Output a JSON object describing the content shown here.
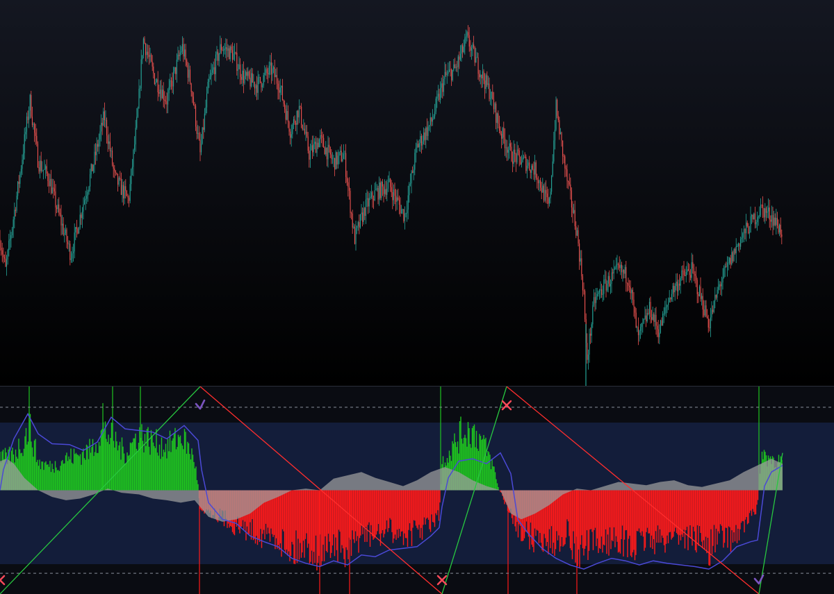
{
  "colors": {
    "background_top": "#141721",
    "background_bottom": "#000000",
    "candle_up": "#26a69a",
    "candle_down": "#ef5350",
    "osc_positive": "#1fc41f",
    "osc_negative": "#ff1a1a",
    "osc_band": "#131d3a",
    "signal_line": "#4b49d6",
    "volume_area": "#9e9e9e",
    "trend_up_line": "#28c840",
    "trend_down_line": "#ff2e2e",
    "marker_x": "#ff4a5a",
    "marker_check": "#7b55c0",
    "dashed_level": "#8a8f9c",
    "pane_divider": "#2a2e39"
  },
  "chart_data": [
    {
      "type": "candlestick",
      "pane": "price",
      "title": "",
      "xlabel": "",
      "ylabel": "",
      "grid": false,
      "legend": "none",
      "ylim": [
        55,
        105
      ],
      "close_path": [
        [
          0,
          74
        ],
        [
          8,
          70
        ],
        [
          28,
          82
        ],
        [
          43,
          92
        ],
        [
          55,
          84
        ],
        [
          70,
          82
        ],
        [
          82,
          78
        ],
        [
          102,
          72
        ],
        [
          118,
          78
        ],
        [
          135,
          84
        ],
        [
          150,
          90
        ],
        [
          165,
          82
        ],
        [
          185,
          79
        ],
        [
          198,
          90
        ],
        [
          206,
          100
        ],
        [
          222,
          95
        ],
        [
          240,
          92
        ],
        [
          262,
          99
        ],
        [
          275,
          94
        ],
        [
          288,
          85
        ],
        [
          300,
          94
        ],
        [
          318,
          99
        ],
        [
          335,
          98
        ],
        [
          350,
          95
        ],
        [
          370,
          94
        ],
        [
          390,
          96
        ],
        [
          402,
          94
        ],
        [
          418,
          88
        ],
        [
          430,
          91
        ],
        [
          445,
          85
        ],
        [
          460,
          87
        ],
        [
          480,
          84
        ],
        [
          495,
          85
        ],
        [
          510,
          74
        ],
        [
          525,
          78
        ],
        [
          540,
          80
        ],
        [
          560,
          81
        ],
        [
          582,
          77
        ],
        [
          600,
          86
        ],
        [
          620,
          89
        ],
        [
          640,
          95
        ],
        [
          655,
          96
        ],
        [
          672,
          100
        ],
        [
          690,
          96
        ],
        [
          705,
          93
        ],
        [
          720,
          88
        ],
        [
          735,
          85
        ],
        [
          755,
          84
        ],
        [
          770,
          83
        ],
        [
          790,
          78
        ],
        [
          800,
          91
        ],
        [
          815,
          82
        ],
        [
          830,
          75
        ],
        [
          840,
          67
        ],
        [
          844,
          58
        ],
        [
          855,
          66
        ],
        [
          870,
          68
        ],
        [
          890,
          70
        ],
        [
          905,
          69
        ],
        [
          918,
          61
        ],
        [
          935,
          65
        ],
        [
          948,
          62
        ],
        [
          965,
          67
        ],
        [
          980,
          69
        ],
        [
          995,
          70
        ],
        [
          1010,
          66
        ],
        [
          1020,
          63
        ],
        [
          1035,
          68
        ],
        [
          1050,
          71
        ],
        [
          1065,
          74
        ],
        [
          1080,
          76
        ],
        [
          1095,
          78
        ],
        [
          1110,
          77
        ],
        [
          1125,
          75
        ]
      ]
    },
    {
      "type": "bar",
      "pane": "oscillator",
      "title": "",
      "xlabel": "",
      "ylabel": "",
      "grid": false,
      "legend": "none",
      "ylim": [
        -1.25,
        1.25
      ],
      "levels": [
        1,
        -1
      ],
      "oscillator_path": [
        [
          0,
          0.45
        ],
        [
          20,
          0.55
        ],
        [
          35,
          0.75
        ],
        [
          42,
          0.98
        ],
        [
          55,
          0.42
        ],
        [
          75,
          0.35
        ],
        [
          95,
          0.48
        ],
        [
          110,
          0.52
        ],
        [
          130,
          0.6
        ],
        [
          148,
          0.9
        ],
        [
          162,
          0.78
        ],
        [
          180,
          0.55
        ],
        [
          200,
          0.85
        ],
        [
          220,
          0.72
        ],
        [
          240,
          0.65
        ],
        [
          262,
          0.82
        ],
        [
          280,
          0.45
        ],
        [
          286,
          0.0
        ],
        [
          287,
          -0.25
        ],
        [
          300,
          -0.3
        ],
        [
          320,
          -0.4
        ],
        [
          340,
          -0.55
        ],
        [
          360,
          -0.6
        ],
        [
          380,
          -0.68
        ],
        [
          400,
          -0.72
        ],
        [
          420,
          -0.9
        ],
        [
          440,
          -0.82
        ],
        [
          460,
          -0.95
        ],
        [
          480,
          -0.78
        ],
        [
          500,
          -1.0
        ],
        [
          520,
          -0.65
        ],
        [
          540,
          -0.7
        ],
        [
          560,
          -0.6
        ],
        [
          580,
          -0.68
        ],
        [
          600,
          -0.62
        ],
        [
          620,
          -0.5
        ],
        [
          632,
          -0.4
        ],
        [
          634,
          0.0
        ],
        [
          636,
          0.42
        ],
        [
          650,
          0.62
        ],
        [
          665,
          0.88
        ],
        [
          680,
          0.9
        ],
        [
          695,
          0.72
        ],
        [
          710,
          0.35
        ],
        [
          718,
          0.0
        ],
        [
          722,
          -0.05
        ],
        [
          730,
          -0.3
        ],
        [
          745,
          -0.55
        ],
        [
          760,
          -0.7
        ],
        [
          780,
          -0.75
        ],
        [
          800,
          -0.8
        ],
        [
          815,
          -0.6
        ],
        [
          830,
          -0.95
        ],
        [
          850,
          -0.82
        ],
        [
          870,
          -0.78
        ],
        [
          890,
          -0.72
        ],
        [
          910,
          -0.9
        ],
        [
          930,
          -0.7
        ],
        [
          950,
          -0.78
        ],
        [
          970,
          -0.65
        ],
        [
          990,
          -0.7
        ],
        [
          1010,
          -0.75
        ],
        [
          1020,
          -0.9
        ],
        [
          1030,
          -0.7
        ],
        [
          1050,
          -0.72
        ],
        [
          1070,
          -0.55
        ],
        [
          1088,
          -0.3
        ],
        [
          1092,
          0.0
        ],
        [
          1095,
          0.55
        ],
        [
          1110,
          0.48
        ],
        [
          1126,
          0.42
        ]
      ],
      "signal_path": [
        [
          0,
          0.0
        ],
        [
          5,
          0.25
        ],
        [
          20,
          0.62
        ],
        [
          40,
          0.92
        ],
        [
          55,
          0.68
        ],
        [
          75,
          0.56
        ],
        [
          100,
          0.55
        ],
        [
          120,
          0.48
        ],
        [
          140,
          0.58
        ],
        [
          160,
          0.88
        ],
        [
          180,
          0.74
        ],
        [
          200,
          0.72
        ],
        [
          220,
          0.7
        ],
        [
          240,
          0.62
        ],
        [
          265,
          0.78
        ],
        [
          285,
          0.6
        ],
        [
          290,
          0.25
        ],
        [
          300,
          -0.15
        ],
        [
          320,
          -0.35
        ],
        [
          340,
          -0.4
        ],
        [
          360,
          -0.55
        ],
        [
          380,
          -0.62
        ],
        [
          400,
          -0.68
        ],
        [
          420,
          -0.82
        ],
        [
          440,
          -0.88
        ],
        [
          460,
          -0.92
        ],
        [
          480,
          -0.85
        ],
        [
          500,
          -0.9
        ],
        [
          520,
          -0.78
        ],
        [
          540,
          -0.8
        ],
        [
          560,
          -0.72
        ],
        [
          580,
          -0.7
        ],
        [
          600,
          -0.68
        ],
        [
          620,
          -0.55
        ],
        [
          632,
          -0.45
        ],
        [
          636,
          -0.2
        ],
        [
          645,
          0.15
        ],
        [
          660,
          0.35
        ],
        [
          680,
          0.38
        ],
        [
          700,
          0.32
        ],
        [
          720,
          0.45
        ],
        [
          735,
          0.2
        ],
        [
          745,
          -0.35
        ],
        [
          760,
          -0.52
        ],
        [
          780,
          -0.7
        ],
        [
          800,
          -0.82
        ],
        [
          820,
          -0.9
        ],
        [
          840,
          -0.95
        ],
        [
          860,
          -0.88
        ],
        [
          880,
          -0.82
        ],
        [
          900,
          -0.85
        ],
        [
          920,
          -0.9
        ],
        [
          940,
          -0.85
        ],
        [
          960,
          -0.88
        ],
        [
          980,
          -0.9
        ],
        [
          1000,
          -0.92
        ],
        [
          1020,
          -0.95
        ],
        [
          1040,
          -0.85
        ],
        [
          1060,
          -0.68
        ],
        [
          1080,
          -0.62
        ],
        [
          1090,
          -0.6
        ],
        [
          1100,
          0.05
        ],
        [
          1110,
          0.22
        ],
        [
          1126,
          0.3
        ]
      ],
      "volume_area_path": [
        [
          0,
          0.35
        ],
        [
          10,
          0.38
        ],
        [
          20,
          0.32
        ],
        [
          35,
          0.15
        ],
        [
          55,
          0.0
        ],
        [
          75,
          -0.08
        ],
        [
          95,
          -0.12
        ],
        [
          115,
          -0.1
        ],
        [
          135,
          -0.05
        ],
        [
          155,
          0.02
        ],
        [
          175,
          -0.03
        ],
        [
          200,
          -0.05
        ],
        [
          220,
          -0.1
        ],
        [
          240,
          -0.12
        ],
        [
          260,
          -0.15
        ],
        [
          280,
          -0.12
        ],
        [
          300,
          -0.32
        ],
        [
          320,
          -0.38
        ],
        [
          340,
          -0.35
        ],
        [
          360,
          -0.28
        ],
        [
          380,
          -0.15
        ],
        [
          400,
          -0.08
        ],
        [
          420,
          0.0
        ],
        [
          440,
          0.02
        ],
        [
          460,
          0.0
        ],
        [
          480,
          0.14
        ],
        [
          500,
          0.18
        ],
        [
          520,
          0.22
        ],
        [
          540,
          0.15
        ],
        [
          560,
          0.1
        ],
        [
          580,
          0.05
        ],
        [
          600,
          0.12
        ],
        [
          620,
          0.22
        ],
        [
          640,
          0.28
        ],
        [
          660,
          0.22
        ],
        [
          680,
          0.12
        ],
        [
          700,
          0.05
        ],
        [
          720,
          0.0
        ],
        [
          735,
          -0.28
        ],
        [
          750,
          -0.35
        ],
        [
          770,
          -0.28
        ],
        [
          790,
          -0.18
        ],
        [
          810,
          -0.05
        ],
        [
          830,
          0.02
        ],
        [
          850,
          0.0
        ],
        [
          870,
          0.05
        ],
        [
          890,
          0.1
        ],
        [
          910,
          0.08
        ],
        [
          930,
          0.06
        ],
        [
          950,
          0.1
        ],
        [
          970,
          0.12
        ],
        [
          990,
          0.06
        ],
        [
          1010,
          0.04
        ],
        [
          1030,
          0.08
        ],
        [
          1050,
          0.12
        ],
        [
          1070,
          0.22
        ],
        [
          1090,
          0.3
        ],
        [
          1110,
          0.38
        ],
        [
          1126,
          0.32
        ]
      ],
      "trend_lines": [
        {
          "name": "",
          "kind": "up",
          "x1": 0,
          "y1": -1.25,
          "x2": 288,
          "y2": 1.25
        },
        {
          "name": "",
          "kind": "down",
          "x1": 288,
          "y1": 1.25,
          "x2": 636,
          "y2": -1.25
        },
        {
          "name": "",
          "kind": "up",
          "x1": 636,
          "y1": -1.25,
          "x2": 729,
          "y2": 1.25
        },
        {
          "name": "",
          "kind": "down",
          "x1": 729,
          "y1": 1.25,
          "x2": 1092,
          "y2": -1.25
        },
        {
          "name": "",
          "kind": "up",
          "x1": 1092,
          "y1": -1.25,
          "x2": 1126,
          "y2": 0.45
        }
      ],
      "markers": [
        {
          "shape": "x",
          "x": 0,
          "y": -1.25
        },
        {
          "shape": "check",
          "x": 288,
          "y": 1.25
        },
        {
          "shape": "x",
          "x": 636,
          "y": -1.25
        },
        {
          "shape": "x",
          "x": 729,
          "y": 1.25
        },
        {
          "shape": "check",
          "x": 1092,
          "y": -1.25
        }
      ]
    }
  ]
}
